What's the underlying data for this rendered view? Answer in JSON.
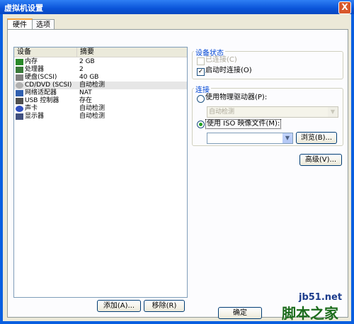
{
  "window": {
    "title": "虚拟机设置",
    "close_label": "X"
  },
  "tabs": [
    {
      "label": "硬件"
    },
    {
      "label": "选项"
    }
  ],
  "device_list": {
    "headers": {
      "device": "设备",
      "summary": "摘要"
    },
    "rows": [
      {
        "device": "内存",
        "summary": "2 GB",
        "icon": "memory-icon",
        "color": "#2a8a2a"
      },
      {
        "device": "处理器",
        "summary": "2",
        "icon": "processor-icon",
        "color": "#3a7a3a"
      },
      {
        "device": "硬盘(SCSI)",
        "summary": "40 GB",
        "icon": "hard-disk-icon",
        "color": "#808080"
      },
      {
        "device": "CD/DVD (SCSI)",
        "summary": "自动检测",
        "icon": "cd-dvd-icon",
        "color": "#b0b0b0"
      },
      {
        "device": "网络适配器",
        "summary": "NAT",
        "icon": "network-adapter-icon",
        "color": "#3060b0"
      },
      {
        "device": "USB 控制器",
        "summary": "存在",
        "icon": "usb-controller-icon",
        "color": "#505050"
      },
      {
        "device": "声卡",
        "summary": "自动检测",
        "icon": "sound-card-icon",
        "color": "#3050c0"
      },
      {
        "device": "显示器",
        "summary": "自动检测",
        "icon": "display-icon",
        "color": "#405080"
      }
    ]
  },
  "buttons": {
    "add": "添加(A)...",
    "remove": "移除(R)",
    "ok": "确定",
    "browse": "浏览(B)...",
    "advanced": "高级(V)..."
  },
  "device_status": {
    "group_label": "设备状态",
    "connected": {
      "label": "已连接(C)",
      "checked": false,
      "enabled": false
    },
    "connect_at_power_on": {
      "label": "启动时连接(O)",
      "checked": true
    }
  },
  "connection": {
    "group_label": "连接",
    "physical_drive": {
      "label": "使用物理驱动器(P):",
      "selected": false,
      "combo_value": "自动检测"
    },
    "iso_image": {
      "label": "使用 ISO 映像文件(M):",
      "selected": true,
      "combo_value": ""
    }
  },
  "watermark": {
    "site": "jb51.net",
    "name": "脚本之家"
  }
}
